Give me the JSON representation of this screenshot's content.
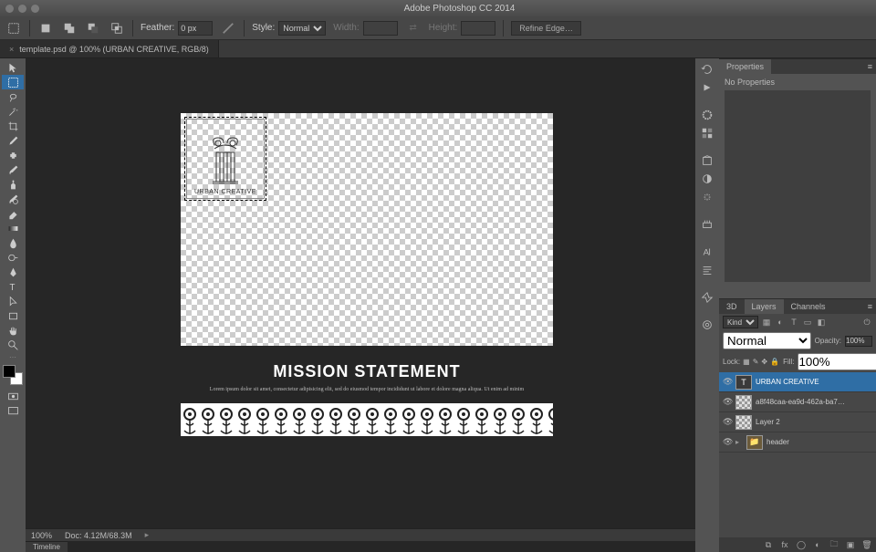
{
  "app": {
    "title": "Adobe Photoshop CC 2014"
  },
  "options": {
    "feather_label": "Feather:",
    "feather_value": "0 px",
    "style_label": "Style:",
    "style_value": "Normal",
    "width_label": "Width:",
    "height_label": "Height:",
    "refine_edge": "Refine Edge…"
  },
  "doc_tab": {
    "label": "template.psd @ 100% (URBAN CREATIVE, RGB/8)",
    "close": "×"
  },
  "tools": [
    "move",
    "marquee",
    "lasso",
    "wand",
    "crop",
    "eyedropper",
    "spot-heal",
    "brush",
    "clone",
    "history-brush",
    "eraser",
    "gradient",
    "blur",
    "dodge",
    "pen",
    "type",
    "path-select",
    "rectangle",
    "hand",
    "zoom"
  ],
  "canvas": {
    "logo_text": "URBAN CREATIVE",
    "mission_title": "MISSION STATEMENT",
    "mission_sub": "Lorem ipsum dolor sit amet, consectetur adipisicing elit, sed do eiusmod tempor incididunt ut labore et dolore magna aliqua. Ut enim ad minim"
  },
  "status": {
    "zoom": "100%",
    "doc": "Doc: 4.12M/68.3M"
  },
  "timeline": {
    "label": "Timeline"
  },
  "panels": {
    "properties": {
      "tab": "Properties",
      "no_props": "No Properties"
    },
    "layers": {
      "tabs": [
        "3D",
        "Layers",
        "Channels"
      ],
      "kind_label": "Kind",
      "blend_mode": "Normal",
      "opacity_label": "Opacity:",
      "opacity_value": "100%",
      "lock_label": "Lock:",
      "fill_label": "Fill:",
      "fill_value": "100%",
      "items": [
        {
          "type": "type",
          "name": "URBAN CREATIVE",
          "selected": true
        },
        {
          "type": "smart",
          "name": "a8f48caa-ea9d-462a-ba7…",
          "selected": false
        },
        {
          "type": "raster",
          "name": "Layer 2",
          "selected": false
        },
        {
          "type": "group",
          "name": "header",
          "selected": false
        }
      ]
    }
  }
}
